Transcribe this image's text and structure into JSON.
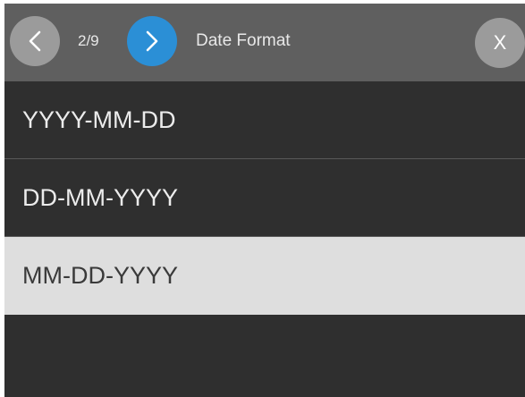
{
  "header": {
    "prev_icon": "chevron-left-icon",
    "next_icon": "chevron-right-icon",
    "page_counter": "2/9",
    "title": "Date Format",
    "close_label": "X"
  },
  "options": [
    {
      "label": "YYYY-MM-DD",
      "selected": false
    },
    {
      "label": "DD-MM-YYYY",
      "selected": false
    },
    {
      "label": "MM-DD-YYYY",
      "selected": true
    }
  ],
  "colors": {
    "header_bg": "#5f5f5f",
    "list_bg": "#2f2f2f",
    "accent": "#2b8fd6",
    "selected_bg": "#dedede"
  }
}
